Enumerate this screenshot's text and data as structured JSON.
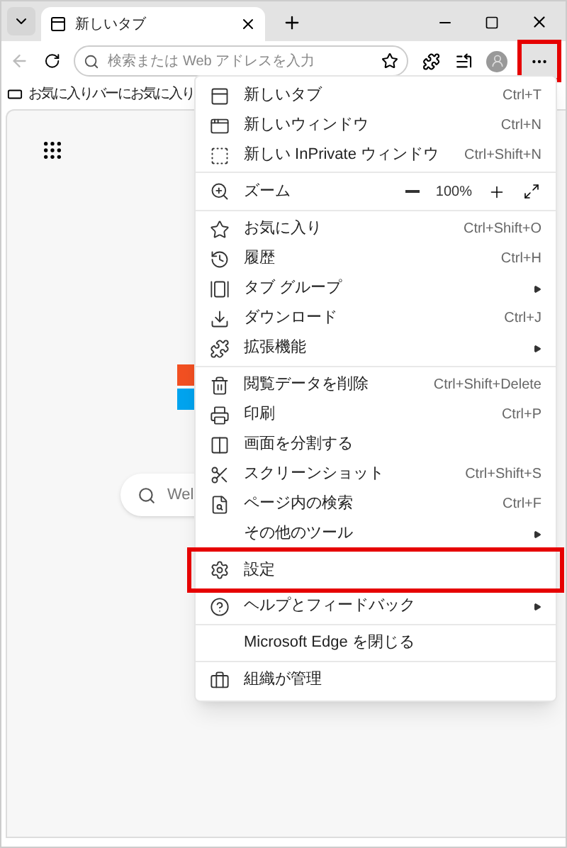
{
  "tab_strip": {
    "tab": {
      "title": "新しいタブ",
      "selected": true
    }
  },
  "address_bar": {
    "placeholder": "検索または Web アドレスを入力"
  },
  "more_button": {
    "highlighted": true
  },
  "favorites_bar": {
    "text": "お気に入りバーにお気に入り"
  },
  "page": {
    "search_text": "Wel"
  },
  "menu": {
    "sections": [
      [
        {
          "kind": "item",
          "label": "新しいタブ",
          "shortcut": "Ctrl+T",
          "submenu": false,
          "highlighted": false
        },
        {
          "kind": "item",
          "label": "新しいウィンドウ",
          "shortcut": "Ctrl+N",
          "submenu": false,
          "highlighted": false
        },
        {
          "kind": "item",
          "label": "新しい InPrivate ウィンドウ",
          "shortcut": "Ctrl+Shift+N",
          "submenu": false,
          "highlighted": false
        }
      ],
      [
        {
          "kind": "zoom",
          "label": "ズーム",
          "value": "100%"
        }
      ],
      [
        {
          "kind": "item",
          "label": "お気に入り",
          "shortcut": "Ctrl+Shift+O",
          "submenu": false,
          "highlighted": false
        },
        {
          "kind": "item",
          "label": "履歴",
          "shortcut": "Ctrl+H",
          "submenu": false,
          "highlighted": false
        },
        {
          "kind": "item",
          "label": "タブ グループ",
          "submenu": true,
          "highlighted": false
        },
        {
          "kind": "item",
          "label": "ダウンロード",
          "shortcut": "Ctrl+J",
          "submenu": false,
          "highlighted": false
        },
        {
          "kind": "item",
          "label": "拡張機能",
          "submenu": true,
          "highlighted": false
        }
      ],
      [
        {
          "kind": "item",
          "label": "閲覧データを削除",
          "shortcut": "Ctrl+Shift+Delete",
          "submenu": false,
          "highlighted": false
        },
        {
          "kind": "item",
          "label": "印刷",
          "shortcut": "Ctrl+P",
          "submenu": false,
          "highlighted": false
        },
        {
          "kind": "item",
          "label": "画面を分割する",
          "submenu": false,
          "highlighted": false
        },
        {
          "kind": "item",
          "label": "スクリーンショット",
          "shortcut": "Ctrl+Shift+S",
          "submenu": false,
          "highlighted": false
        },
        {
          "kind": "item",
          "label": "ページ内の検索",
          "shortcut": "Ctrl+F",
          "submenu": false,
          "highlighted": false
        },
        {
          "kind": "item",
          "label": "その他のツール",
          "submenu": true,
          "highlighted": false
        },
        {
          "kind": "item",
          "label": "設定",
          "submenu": false,
          "highlighted": true
        },
        {
          "kind": "item",
          "label": "ヘルプとフィードバック",
          "submenu": true,
          "highlighted": false
        }
      ],
      [
        {
          "kind": "item",
          "label": "Microsoft Edge を閉じる",
          "submenu": false,
          "highlighted": false
        }
      ],
      [
        {
          "kind": "item",
          "label": "組織が管理",
          "submenu": false,
          "highlighted": false
        }
      ]
    ]
  }
}
